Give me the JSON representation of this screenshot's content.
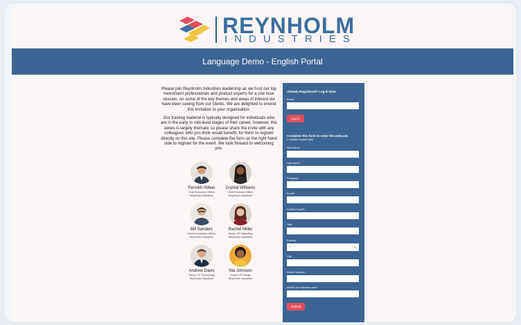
{
  "brand": {
    "name": "REYNHOLM",
    "subname": "INDUSTRIES",
    "colors": {
      "primary": "#3c6594",
      "accent": "#e2505f",
      "logo_red": "#e2505f",
      "logo_yellow": "#f3c542",
      "logo_blue": "#3c6ea0"
    }
  },
  "banner": {
    "title": "Language Demo - English Portal"
  },
  "intro": {
    "paragraphs": [
      "Please join Reynholm Industries leadership as we host our top investment professionals and product experts for a one hour session, on some of the key themes and areas of interest we have been seeing from our clients. We are delighted to extend this invitation to your organisation.",
      "Our training material is typically designed for individuals who are in the early to mid-level stages of their career, however, this series is largely thematic so please share the invite with any colleagues who you think would benefit, for them to register directly on this site. Please complete the form on the right hand side to register for the event. We look forward to welcoming you."
    ]
  },
  "speakers": [
    {
      "name": "Farrukh Abbas",
      "role": "Chief Executive Officer",
      "company": "Reynholm Industries"
    },
    {
      "name": "Crystal Williams",
      "role": "Chief Financial Officer",
      "company": "Reynholm Industries"
    },
    {
      "name": "Bill Sanders",
      "role": "Chief Information Officer",
      "company": "Reynholm Industries"
    },
    {
      "name": "Rachel Miller",
      "role": "Senior VP Marketing",
      "company": "Reynholm Industries"
    },
    {
      "name": "Andrew Davis",
      "role": "Senior VP Technology",
      "company": "Reynholm Industries"
    },
    {
      "name": "Nia Johnson",
      "role": "Senior VP Design",
      "company": "Reynholm Industries"
    }
  ],
  "login": {
    "heading": "Already Registered? Log In Now",
    "email_label": "Email:",
    "email_value": "",
    "button": "Log In"
  },
  "register": {
    "heading": "Complete this form to enter the webcast.",
    "note": "(* indicates required field)",
    "fields": [
      {
        "label": "First Name:",
        "value": ""
      },
      {
        "label": "Last Name:",
        "value": ""
      },
      {
        "label": "Company:",
        "value": ""
      },
      {
        "label": "Email*:",
        "value": ""
      },
      {
        "label": "Confirm Email*:",
        "value": ""
      },
      {
        "label": "Title:",
        "value": ""
      }
    ],
    "country_label": "Country:",
    "country_value": "--",
    "fields2": [
      {
        "label": "City:",
        "value": ""
      },
      {
        "label": "Mobile Number:",
        "value": ""
      },
      {
        "label": "What's your favorite color?",
        "value": ""
      }
    ],
    "submit": "Submit"
  }
}
